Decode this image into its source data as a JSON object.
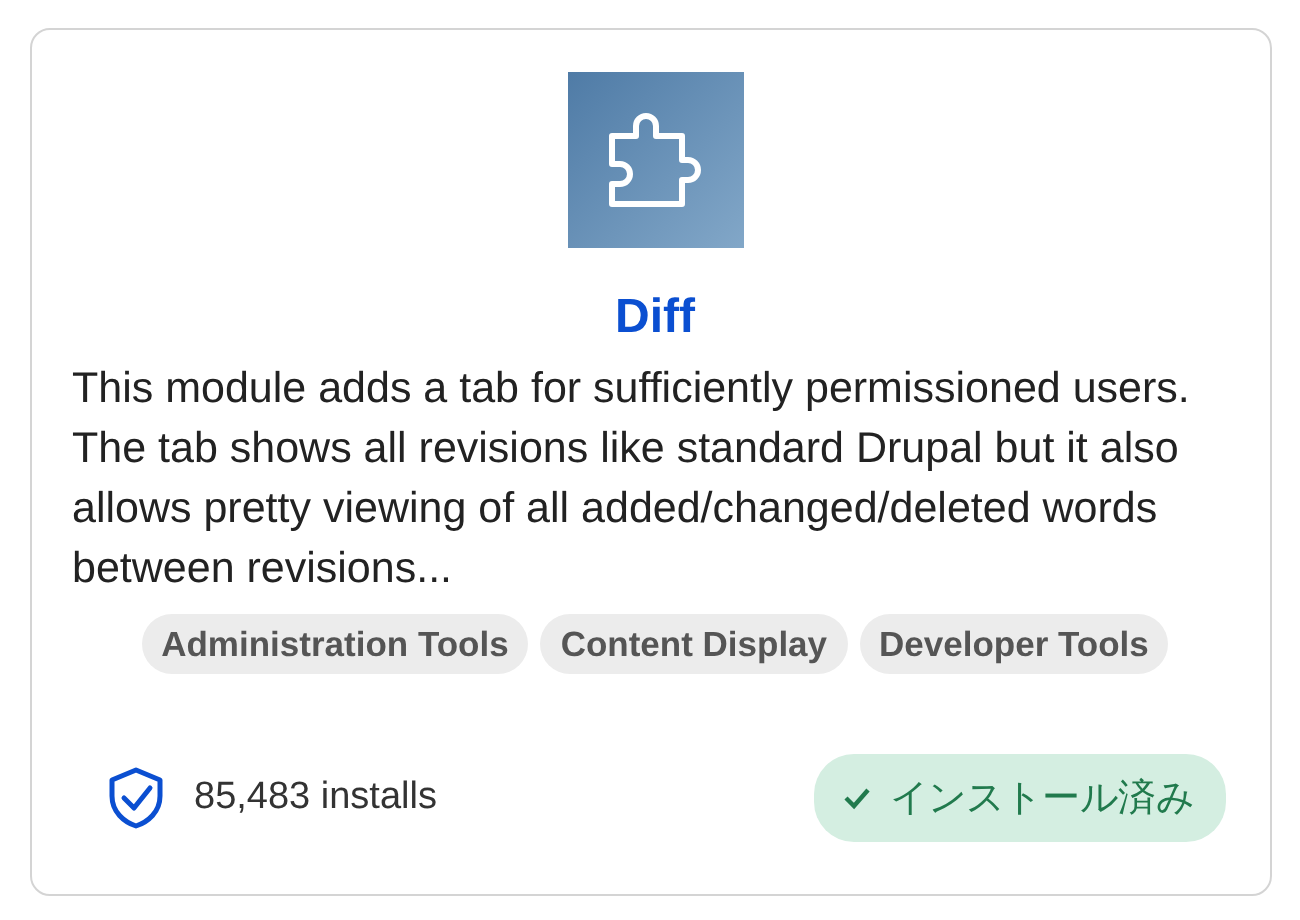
{
  "module": {
    "title": "Diff",
    "description": "This module adds a tab for sufficiently permissioned users. The tab shows all revisions like standard Drupal but it also allows pretty viewing of all added/changed/deleted words between revisions...",
    "tags": [
      "Administration Tools",
      "Content Display",
      "Developer Tools"
    ],
    "installs": "85,483 installs",
    "status": {
      "label": "インストール済み",
      "installed": true
    }
  }
}
